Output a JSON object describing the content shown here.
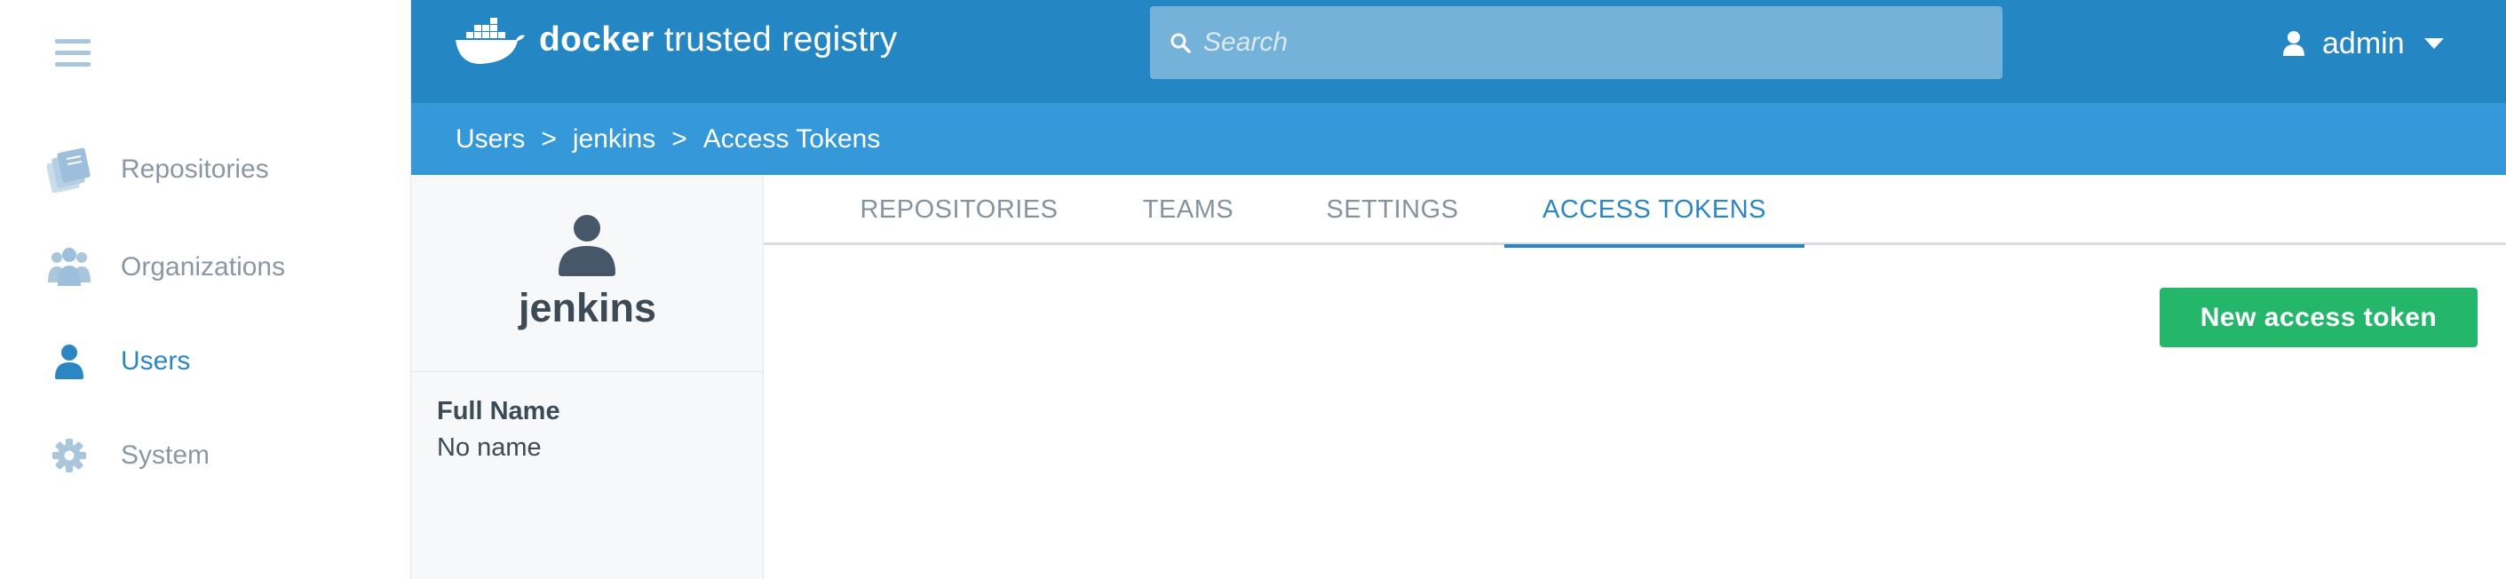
{
  "app": {
    "logo_bold": "docker",
    "logo_rest": " trusted registry"
  },
  "search": {
    "placeholder": "Search",
    "value": ""
  },
  "user_menu": {
    "name": "admin"
  },
  "sidebar": {
    "items": [
      {
        "label": "Repositories",
        "icon": "repositories-icon",
        "active": false
      },
      {
        "label": "Organizations",
        "icon": "organizations-icon",
        "active": false
      },
      {
        "label": "Users",
        "icon": "user-icon",
        "active": true
      },
      {
        "label": "System",
        "icon": "gear-icon",
        "active": false
      }
    ]
  },
  "breadcrumb": {
    "items": [
      "Users",
      "jenkins",
      "Access Tokens"
    ],
    "separator": ">"
  },
  "profile": {
    "username": "jenkins",
    "full_name_label": "Full Name",
    "full_name_value": "No name"
  },
  "tabs": [
    {
      "label": "REPOSITORIES",
      "active": false
    },
    {
      "label": "TEAMS",
      "active": false
    },
    {
      "label": "SETTINGS",
      "active": false
    },
    {
      "label": "ACCESS TOKENS",
      "active": true
    }
  ],
  "actions": {
    "new_token_label": "New access token"
  },
  "colors": {
    "header": "#2486c2",
    "breadcrumb_bar": "#3598d8",
    "accent": "#2c86c2",
    "primary_button": "#24b66b",
    "sidebar_icon": "#a9c6dd"
  }
}
